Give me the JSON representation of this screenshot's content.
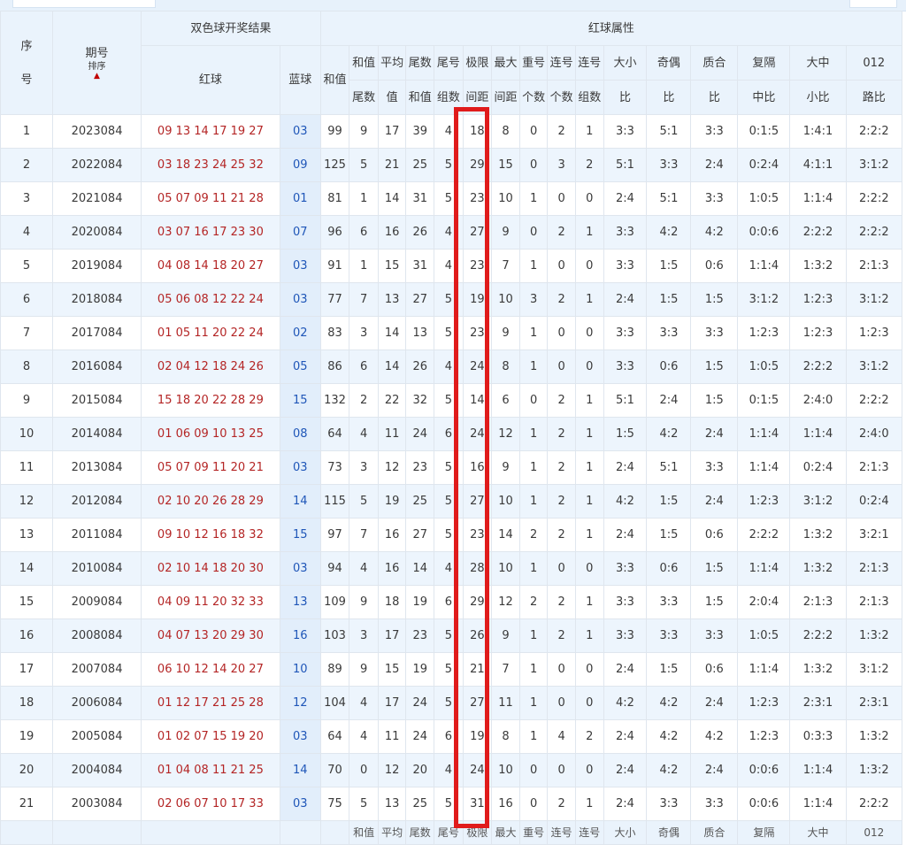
{
  "header": {
    "seq_top": "序",
    "seq_bottom": "号",
    "period": "期号",
    "sort_label": "排序",
    "sort_arrow": "▲",
    "draw_group": "双色球开奖结果",
    "red_ball": "红球",
    "blue_ball": "蓝球",
    "sum": "和值",
    "attr_group": "红球属性",
    "cols": [
      {
        "top": "和值",
        "bottom": "尾数"
      },
      {
        "top": "平均",
        "bottom": "值"
      },
      {
        "top": "尾数",
        "bottom": "和值"
      },
      {
        "top": "尾号",
        "bottom": "组数"
      },
      {
        "top": "极限",
        "bottom": "间距"
      },
      {
        "top": "最大",
        "bottom": "间距"
      },
      {
        "top": "重号",
        "bottom": "个数"
      },
      {
        "top": "连号",
        "bottom": "个数"
      },
      {
        "top": "连号",
        "bottom": "组数"
      },
      {
        "top": "大小",
        "bottom": "比"
      },
      {
        "top": "奇偶",
        "bottom": "比"
      },
      {
        "top": "质合",
        "bottom": "比"
      },
      {
        "top": "复隔",
        "bottom": "中比"
      },
      {
        "top": "大中",
        "bottom": "小比"
      },
      {
        "top": "012",
        "bottom": "路比"
      }
    ]
  },
  "rows": [
    [
      "1",
      "2023084",
      "09 13 14 17 19 27",
      "03",
      "99",
      "9",
      "17",
      "39",
      "4",
      "18",
      "8",
      "0",
      "2",
      "1",
      "3:3",
      "5:1",
      "3:3",
      "0:1:5",
      "1:4:1",
      "2:2:2"
    ],
    [
      "2",
      "2022084",
      "03 18 23 24 25 32",
      "09",
      "125",
      "5",
      "21",
      "25",
      "5",
      "29",
      "15",
      "0",
      "3",
      "2",
      "5:1",
      "3:3",
      "2:4",
      "0:2:4",
      "4:1:1",
      "3:1:2"
    ],
    [
      "3",
      "2021084",
      "05 07 09 11 21 28",
      "01",
      "81",
      "1",
      "14",
      "31",
      "5",
      "23",
      "10",
      "1",
      "0",
      "0",
      "2:4",
      "5:1",
      "3:3",
      "1:0:5",
      "1:1:4",
      "2:2:2"
    ],
    [
      "4",
      "2020084",
      "03 07 16 17 23 30",
      "07",
      "96",
      "6",
      "16",
      "26",
      "4",
      "27",
      "9",
      "0",
      "2",
      "1",
      "3:3",
      "4:2",
      "4:2",
      "0:0:6",
      "2:2:2",
      "2:2:2"
    ],
    [
      "5",
      "2019084",
      "04 08 14 18 20 27",
      "03",
      "91",
      "1",
      "15",
      "31",
      "4",
      "23",
      "7",
      "1",
      "0",
      "0",
      "3:3",
      "1:5",
      "0:6",
      "1:1:4",
      "1:3:2",
      "2:1:3"
    ],
    [
      "6",
      "2018084",
      "05 06 08 12 22 24",
      "03",
      "77",
      "7",
      "13",
      "27",
      "5",
      "19",
      "10",
      "3",
      "2",
      "1",
      "2:4",
      "1:5",
      "1:5",
      "3:1:2",
      "1:2:3",
      "3:1:2"
    ],
    [
      "7",
      "2017084",
      "01 05 11 20 22 24",
      "02",
      "83",
      "3",
      "14",
      "13",
      "5",
      "23",
      "9",
      "1",
      "0",
      "0",
      "3:3",
      "3:3",
      "3:3",
      "1:2:3",
      "1:2:3",
      "1:2:3"
    ],
    [
      "8",
      "2016084",
      "02 04 12 18 24 26",
      "05",
      "86",
      "6",
      "14",
      "26",
      "4",
      "24",
      "8",
      "1",
      "0",
      "0",
      "3:3",
      "0:6",
      "1:5",
      "1:0:5",
      "2:2:2",
      "3:1:2"
    ],
    [
      "9",
      "2015084",
      "15 18 20 22 28 29",
      "15",
      "132",
      "2",
      "22",
      "32",
      "5",
      "14",
      "6",
      "0",
      "2",
      "1",
      "5:1",
      "2:4",
      "1:5",
      "0:1:5",
      "2:4:0",
      "2:2:2"
    ],
    [
      "10",
      "2014084",
      "01 06 09 10 13 25",
      "08",
      "64",
      "4",
      "11",
      "24",
      "6",
      "24",
      "12",
      "1",
      "2",
      "1",
      "1:5",
      "4:2",
      "2:4",
      "1:1:4",
      "1:1:4",
      "2:4:0"
    ],
    [
      "11",
      "2013084",
      "05 07 09 11 20 21",
      "03",
      "73",
      "3",
      "12",
      "23",
      "5",
      "16",
      "9",
      "1",
      "2",
      "1",
      "2:4",
      "5:1",
      "3:3",
      "1:1:4",
      "0:2:4",
      "2:1:3"
    ],
    [
      "12",
      "2012084",
      "02 10 20 26 28 29",
      "14",
      "115",
      "5",
      "19",
      "25",
      "5",
      "27",
      "10",
      "1",
      "2",
      "1",
      "4:2",
      "1:5",
      "2:4",
      "1:2:3",
      "3:1:2",
      "0:2:4"
    ],
    [
      "13",
      "2011084",
      "09 10 12 16 18 32",
      "15",
      "97",
      "7",
      "16",
      "27",
      "5",
      "23",
      "14",
      "2",
      "2",
      "1",
      "2:4",
      "1:5",
      "0:6",
      "2:2:2",
      "1:3:2",
      "3:2:1"
    ],
    [
      "14",
      "2010084",
      "02 10 14 18 20 30",
      "03",
      "94",
      "4",
      "16",
      "14",
      "4",
      "28",
      "10",
      "1",
      "0",
      "0",
      "3:3",
      "0:6",
      "1:5",
      "1:1:4",
      "1:3:2",
      "2:1:3"
    ],
    [
      "15",
      "2009084",
      "04 09 11 20 32 33",
      "13",
      "109",
      "9",
      "18",
      "19",
      "6",
      "29",
      "12",
      "2",
      "2",
      "1",
      "3:3",
      "3:3",
      "1:5",
      "2:0:4",
      "2:1:3",
      "2:1:3"
    ],
    [
      "16",
      "2008084",
      "04 07 13 20 29 30",
      "16",
      "103",
      "3",
      "17",
      "23",
      "5",
      "26",
      "9",
      "1",
      "2",
      "1",
      "3:3",
      "3:3",
      "3:3",
      "1:0:5",
      "2:2:2",
      "1:3:2"
    ],
    [
      "17",
      "2007084",
      "06 10 12 14 20 27",
      "10",
      "89",
      "9",
      "15",
      "19",
      "5",
      "21",
      "7",
      "1",
      "0",
      "0",
      "2:4",
      "1:5",
      "0:6",
      "1:1:4",
      "1:3:2",
      "3:1:2"
    ],
    [
      "18",
      "2006084",
      "01 12 17 21 25 28",
      "12",
      "104",
      "4",
      "17",
      "24",
      "5",
      "27",
      "11",
      "1",
      "0",
      "0",
      "4:2",
      "4:2",
      "2:4",
      "1:2:3",
      "2:3:1",
      "2:3:1"
    ],
    [
      "19",
      "2005084",
      "01 02 07 15 19 20",
      "03",
      "64",
      "4",
      "11",
      "24",
      "6",
      "19",
      "8",
      "1",
      "4",
      "2",
      "2:4",
      "4:2",
      "4:2",
      "1:2:3",
      "0:3:3",
      "1:3:2"
    ],
    [
      "20",
      "2004084",
      "01 04 08 11 21 25",
      "14",
      "70",
      "0",
      "12",
      "20",
      "4",
      "24",
      "10",
      "0",
      "0",
      "0",
      "2:4",
      "4:2",
      "2:4",
      "0:0:6",
      "1:1:4",
      "1:3:2"
    ],
    [
      "21",
      "2003084",
      "02 06 07 10 17 33",
      "03",
      "75",
      "5",
      "13",
      "25",
      "5",
      "31",
      "16",
      "0",
      "2",
      "1",
      "2:4",
      "3:3",
      "3:3",
      "0:0:6",
      "1:1:4",
      "2:2:2"
    ]
  ],
  "footer": [
    "和值",
    "平均",
    "尾数",
    "尾号",
    "极限",
    "最大",
    "重号",
    "连号",
    "连号",
    "大小",
    "奇偶",
    "质合",
    "复隔",
    "大中",
    "012"
  ],
  "colors": {
    "red_ball": "#b42525",
    "blue_ball": "#1f56b8",
    "highlight": "#e01b1b"
  }
}
